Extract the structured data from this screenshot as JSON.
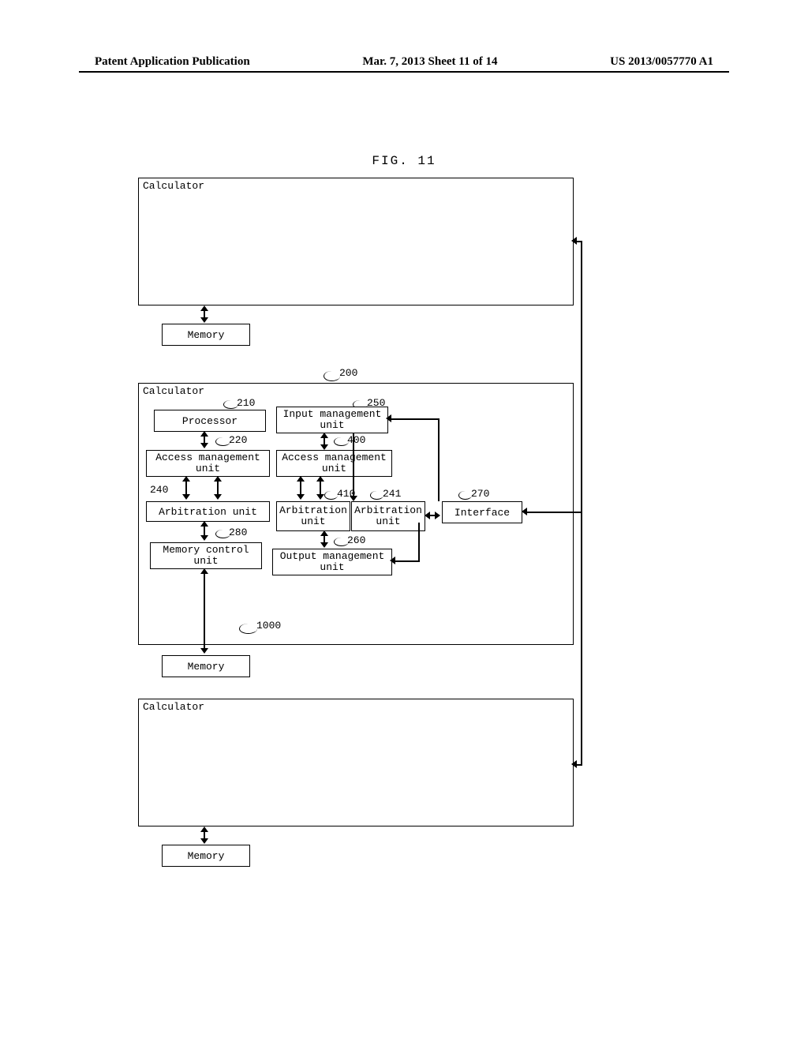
{
  "header": {
    "left": "Patent Application Publication",
    "center": "Mar. 7, 2013  Sheet 11 of 14",
    "right": "US 2013/0057770 A1"
  },
  "figure_title": "FIG. 11",
  "blocks": {
    "calc_top": "Calculator",
    "mem_top": "Memory",
    "calc_mid": "Calculator",
    "processor": "Processor",
    "input_mgmt": "Input management unit",
    "access_mgmt_1": "Access management unit",
    "access_mgmt_2": "Access management unit",
    "arb_unit_1": "Arbitration unit",
    "arb_unit_2": "Arbitration unit",
    "arb_unit_3": "Arbitration unit",
    "interface": "Interface",
    "mem_ctrl": "Memory control unit",
    "output_mgmt": "Output management unit",
    "mem_mid": "Memory",
    "calc_bot": "Calculator",
    "mem_bot": "Memory"
  },
  "refs": {
    "r200": "200",
    "r210": "210",
    "r250": "250",
    "r220": "220",
    "r400": "400",
    "r240": "240",
    "r410": "410",
    "r241": "241",
    "r270": "270",
    "r280": "280",
    "r260": "260",
    "r1000": "1000"
  }
}
